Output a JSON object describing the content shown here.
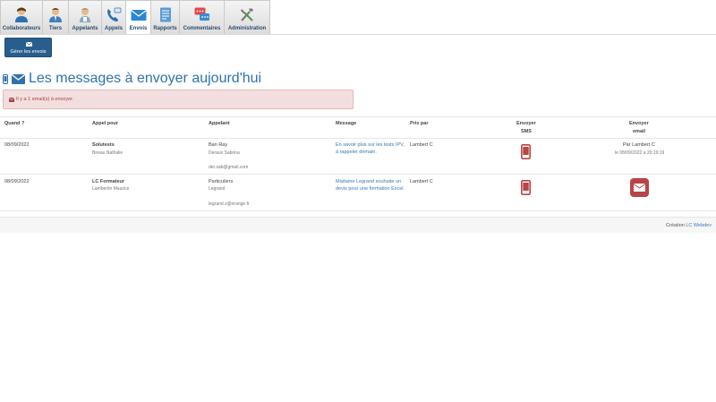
{
  "nav": {
    "tabs": [
      {
        "label": "Collaborateurs",
        "icon": "collaborators-icon"
      },
      {
        "label": "Tiers",
        "icon": "third-party-icon"
      },
      {
        "label": "Appelants",
        "icon": "callers-icon"
      },
      {
        "label": "Appels",
        "icon": "calls-icon"
      },
      {
        "label": "Envois",
        "icon": "mail-icon"
      },
      {
        "label": "Rapports",
        "icon": "reports-icon"
      },
      {
        "label": "Commentaires",
        "icon": "comments-icon"
      },
      {
        "label": "Administration",
        "icon": "tools-icon"
      }
    ],
    "active": "Envois"
  },
  "toolbar": {
    "manage_label": "Gérer les envois"
  },
  "page": {
    "title": "Les messages à envoyer aujourd'hui",
    "alert": "Il y a 1 email(s) à envoyer."
  },
  "table": {
    "headers": {
      "when": "Quand ?",
      "call_for": "Appel pour",
      "caller": "Appelant",
      "message": "Message",
      "taken_by": "Pris par",
      "send_sms_1": "Envoyer",
      "send_sms_2": "SMS",
      "send_email_1": "Envoyer",
      "send_email_2": "email"
    },
    "rows": [
      {
        "when": "08/09/2022",
        "call_for": "Solutests",
        "call_for_contact": "Bireau Nathalie",
        "caller": "Ban Ray",
        "caller_sub": "Deraux Sabrina",
        "caller_email": "der.sab@gmail.com",
        "message": "En savoir plus sur les tests IPV, à rappeler demain.",
        "taken_by": "Lambert C",
        "email_status": "Par Lambert C",
        "email_date": "le 08/09/2022 à 20:19:19"
      },
      {
        "when": "08/09/2022",
        "call_for": "LC Formateur",
        "call_for_contact": "Lambertin Maurice",
        "caller": "Particuliers",
        "caller_sub": "Legrand",
        "caller_email": "legrand.s@orange.fr",
        "message": "Madame Legrand souhaite un devis pour une formation Excel.",
        "taken_by": "Lambert C",
        "email_status": "",
        "email_date": ""
      }
    ]
  },
  "footer": {
    "prefix": "Création",
    "link": "LC Webdev"
  },
  "colors": {
    "accent": "#2f72ad",
    "button": "#285e8e",
    "danger": "#b94446",
    "alert_bg": "#f2dede"
  }
}
